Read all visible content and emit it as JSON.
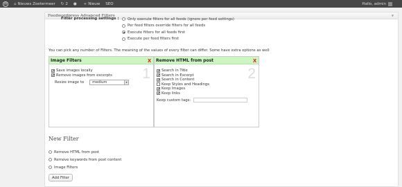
{
  "adminbar": {
    "site": "Nieuws Zoetermeer",
    "updates": "2",
    "new": "Nieuw",
    "seo": "SEO",
    "greeting": "Hallo, admin"
  },
  "panel": {
    "title": "Feedwordpress Advanced Filters",
    "settings_label": "Filter processing settings :",
    "options": [
      {
        "label": "Only execute filters for all feeds (ignore per feed settings)",
        "checked": false
      },
      {
        "label": "Per feed filters override filters for all feeds",
        "checked": false
      },
      {
        "label": "Execute filters for all feeds first",
        "checked": true
      },
      {
        "label": "Execute per feed filters first",
        "checked": false
      }
    ],
    "intro": "You can pick any number of Filters. The meaning of the values of every filter can differ. Some have extra options as well"
  },
  "filters": [
    {
      "title": "Image Filters",
      "number": "1",
      "checkboxes": [
        {
          "label": "Save images locally",
          "checked": true
        },
        {
          "label": "Remove images from excerpts",
          "checked": true
        }
      ],
      "resize_label": "Resize image to",
      "resize_value": "medium"
    },
    {
      "title": "Remove HTML from post",
      "number": "2",
      "checkboxes": [
        {
          "label": "Search in Title",
          "checked": true
        },
        {
          "label": "Search in Excerpt",
          "checked": true
        },
        {
          "label": "Search in Content",
          "checked": true
        },
        {
          "label": "Keep Styles and Headings",
          "checked": false
        },
        {
          "label": "Keep Images",
          "checked": true
        },
        {
          "label": "Keep links",
          "checked": true
        }
      ],
      "custom_tags_label": "Keep custom tags:"
    }
  ],
  "new_filter": {
    "title": "New Filter",
    "options": [
      "Remove HTML from post",
      "Remove keywords from post content",
      "Image Filters"
    ],
    "button": "Add Filter"
  }
}
